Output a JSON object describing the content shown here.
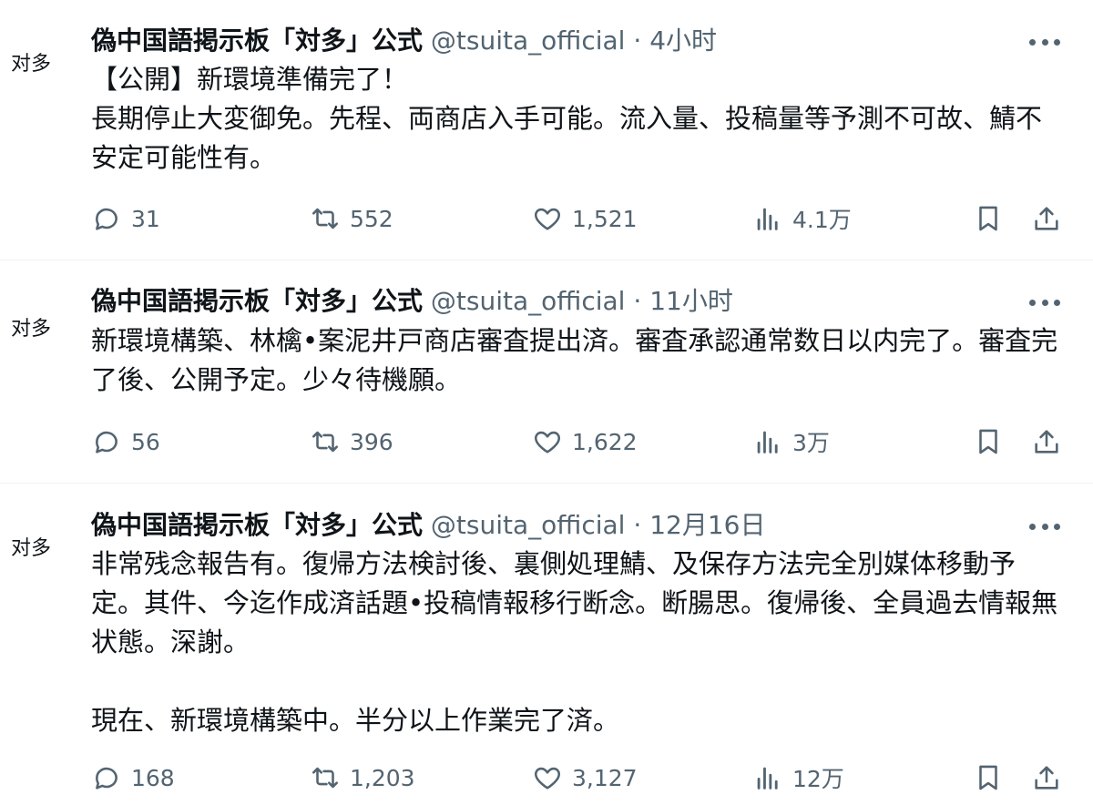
{
  "posts": [
    {
      "avatar_text": "对多",
      "name": "偽中国語掲示板「対多」公式",
      "handle": "@tsuita_official",
      "separator": "·",
      "time": "4小时",
      "body": [
        "【公開】新環境準備完了！\n長期停止大変御免。先程、両商店入手可能。流入量、投稿量等予測不可故、鯖不安定可能性有。"
      ],
      "replies": "31",
      "reposts": "552",
      "likes": "1,521",
      "views": "4.1万"
    },
    {
      "avatar_text": "对多",
      "name": "偽中国語掲示板「対多」公式",
      "handle": "@tsuita_official",
      "separator": "·",
      "time": "11小时",
      "body": [
        "新環境構築、林檎•案泥井戸商店審査提出済。審査承認通常数日以内完了。審査完了後、公開予定。少々待機願。"
      ],
      "replies": "56",
      "reposts": "396",
      "likes": "1,622",
      "views": "3万"
    },
    {
      "avatar_text": "对多",
      "name": "偽中国語掲示板「対多」公式",
      "handle": "@tsuita_official",
      "separator": "·",
      "time": "12月16日",
      "body": [
        "非常残念報告有。復帰方法検討後、裏側処理鯖、及保存方法完全別媒体移動予定。其件、今迄作成済話題•投稿情報移行断念。断腸思。復帰後、全員過去情報無状態。深謝。",
        "現在、新環境構築中。半分以上作業完了済。"
      ],
      "replies": "168",
      "reposts": "1,203",
      "likes": "3,127",
      "views": "12万"
    }
  ],
  "colors": {
    "text": "#0f1419",
    "muted": "#536471",
    "divider": "#eff3f4"
  },
  "icons": [
    "reply-icon",
    "repost-icon",
    "like-icon",
    "views-icon",
    "bookmark-icon",
    "share-icon",
    "more-icon"
  ]
}
